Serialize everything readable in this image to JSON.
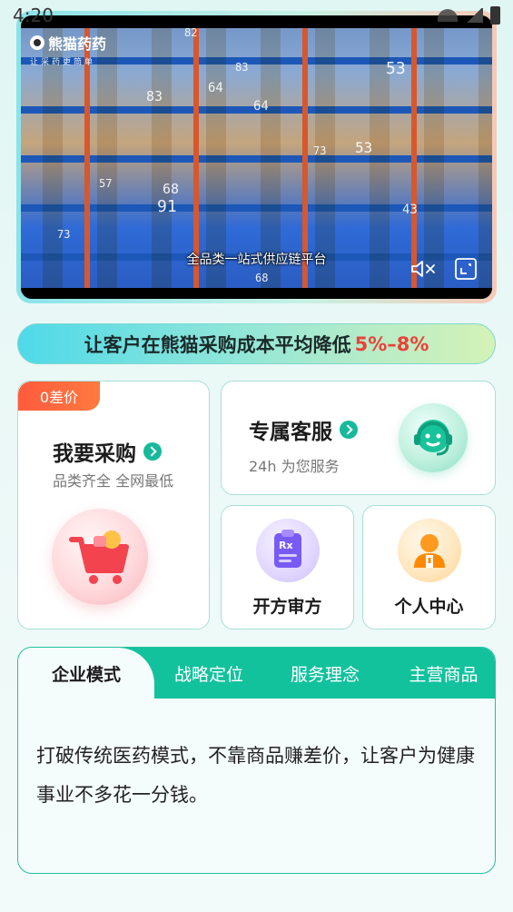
{
  "status_bar": {
    "time": "4:20"
  },
  "video": {
    "logo_name": "熊猫药药",
    "logo_tagline": "让采药更简单",
    "caption": "全品类一站式供应链平台",
    "shelf_numbers": [
      "82",
      "83",
      "64",
      "64",
      "83",
      "53",
      "53",
      "73",
      "68",
      "91",
      "57",
      "43",
      "73",
      "68"
    ]
  },
  "banner": {
    "text": "让客户在熊猫采购成本平均降低",
    "highlight": "5%–8%",
    "highlight_color": "#e8433a"
  },
  "cards": {
    "purchase": {
      "badge": "0差价",
      "title": "我要采购",
      "subtitle": "品类齐全 全网最低",
      "icon": "shopping-cart-icon"
    },
    "service": {
      "title": "专属客服",
      "subtitle": "24h 为您服务",
      "icon": "customer-service-headset-icon"
    },
    "prescription": {
      "label": "开方审方",
      "icon": "rx-clipboard-icon"
    },
    "personal": {
      "label": "个人中心",
      "icon": "doctor-avatar-icon"
    }
  },
  "tabs": {
    "items": [
      {
        "label": "企业模式",
        "active": true
      },
      {
        "label": "战略定位",
        "active": false
      },
      {
        "label": "服务理念",
        "active": false
      },
      {
        "label": "主营商品",
        "active": false
      }
    ],
    "content": "打破传统医药模式，不靠商品赚差价，让客户为健康事业不多花一分钱。"
  },
  "colors": {
    "accent": "#12c29d",
    "badge": "#ff5b3d"
  }
}
